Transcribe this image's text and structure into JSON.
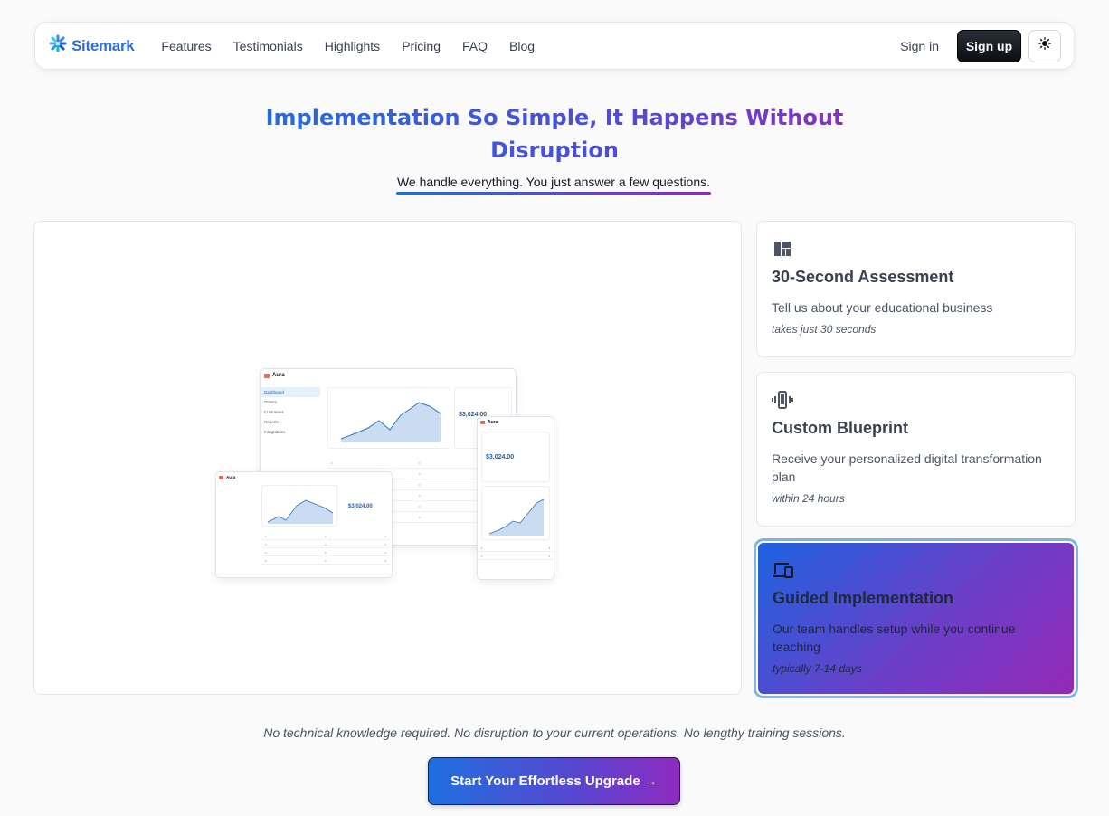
{
  "brand": {
    "name": "Sitemark",
    "icon": "sitemark-logo-icon"
  },
  "nav": {
    "links": [
      "Features",
      "Testimonials",
      "Highlights",
      "Pricing",
      "FAQ",
      "Blog"
    ],
    "sign_in": "Sign in",
    "sign_up": "Sign up",
    "theme_icon": "sun-icon"
  },
  "hero": {
    "title": "Implementation So Simple, It Happens Without Disruption",
    "subtitle": "We handle everything. You just answer a few questions."
  },
  "preview": {
    "app_name": "Aura",
    "price": "$3,024.00",
    "sidebar": [
      "Dashboard",
      "Orders",
      "Customers",
      "Reports",
      "Integrations"
    ]
  },
  "cards": [
    {
      "icon": "dashboard-grid-icon",
      "title": "30-Second Assessment",
      "description": "Tell us about your educational business",
      "note": "takes just 30 seconds",
      "active": false
    },
    {
      "icon": "phone-vibrate-icon",
      "title": "Custom Blueprint",
      "description": "Receive your personalized digital transformation plan",
      "note": "within 24 hours",
      "active": false
    },
    {
      "icon": "devices-icon",
      "title": "Guided Implementation",
      "description": "Our team handles setup while you continue teaching",
      "note": "typically 7-14 days",
      "active": true
    }
  ],
  "footer": {
    "note": "No technical knowledge required. No disruption to your current operations. No lengthy training sessions.",
    "cta": "Start Your Effortless Upgrade →"
  },
  "colors": {
    "brand_blue": "#2f6fd8",
    "gradient_start": "#1f6fe0",
    "gradient_end": "#8e2bc0"
  }
}
